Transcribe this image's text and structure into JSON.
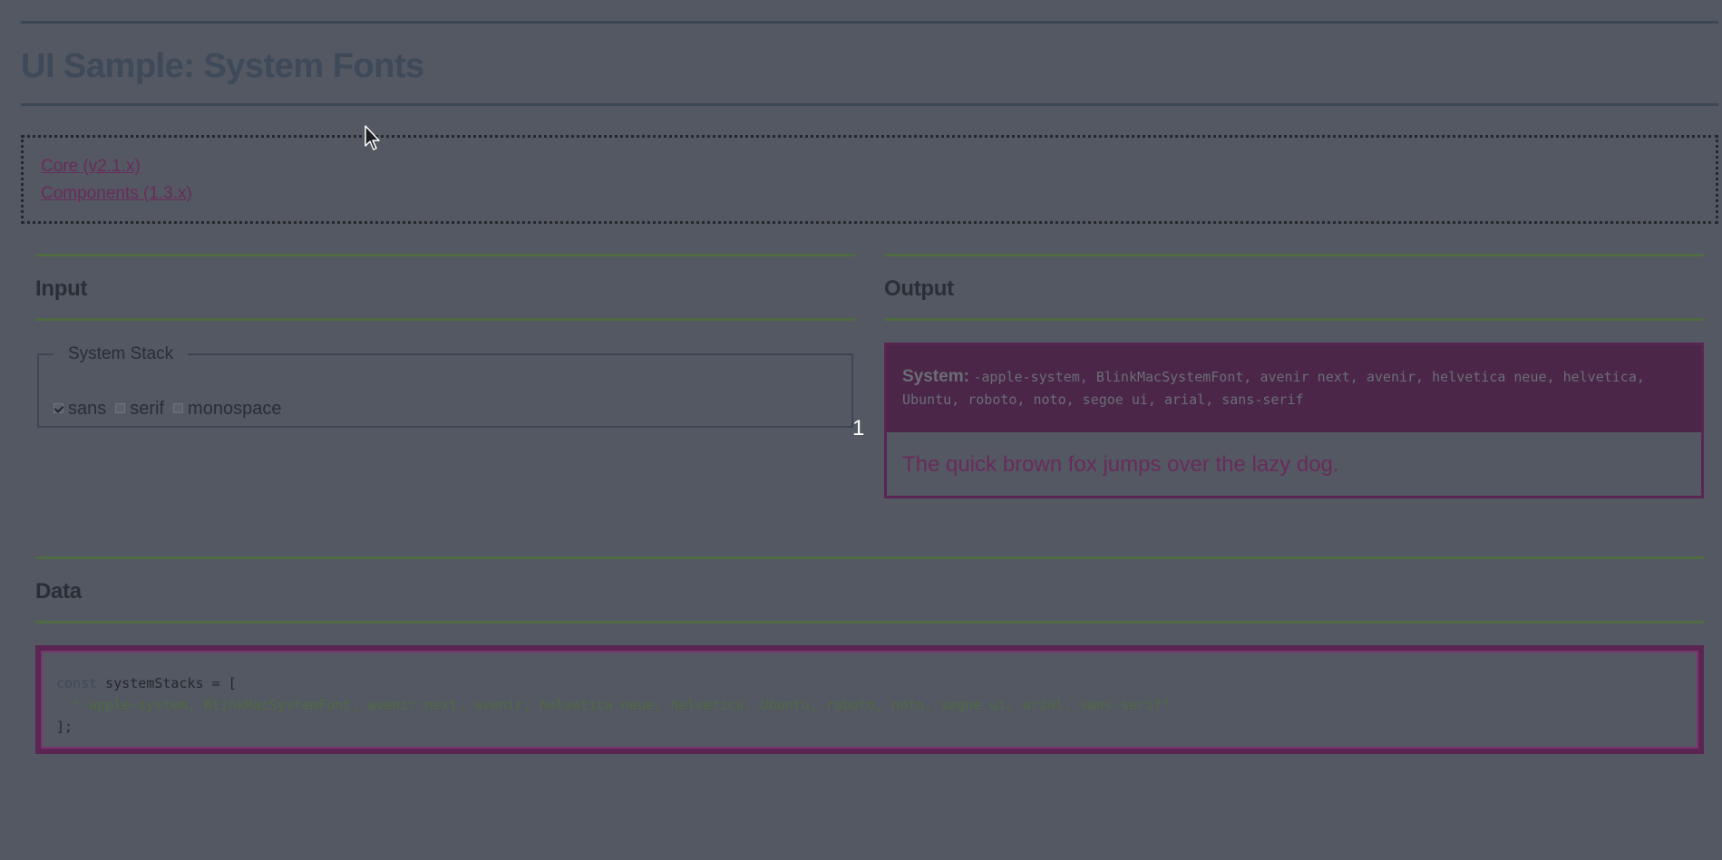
{
  "page": {
    "title": "UI Sample: System Fonts"
  },
  "nav": {
    "links": [
      {
        "label": "Core (v2.1.x)"
      },
      {
        "label": "Components (1.3.x)"
      }
    ]
  },
  "input": {
    "heading": "Input",
    "fieldset_legend": "System Stack",
    "options": [
      {
        "label": "sans",
        "checked": true
      },
      {
        "label": "serif",
        "checked": false
      },
      {
        "label": "monospace",
        "checked": false
      }
    ],
    "marker": "1"
  },
  "output": {
    "heading": "Output",
    "system_label": "System:",
    "system_fonts": "-apple-system, BlinkMacSystemFont, avenir next, avenir, helvetica neue, helvetica, Ubuntu, roboto, noto, segoe ui, arial, sans-serif",
    "sample_text": "The quick brown fox jumps over the lazy dog."
  },
  "data_section": {
    "heading": "Data",
    "code_line1_kw": "const",
    "code_line1_rest": " systemStacks = [",
    "code_line2": "  \"-apple-system, BlinkMacSystemFont, avenir next, avenir, helvetica neue, helvetica, Ubuntu, roboto, noto, segoe ui, arial, sans-serif\"",
    "code_line3": "];"
  },
  "colors": {
    "background": "#535862",
    "accent_green": "#4f6b42",
    "accent_purple": "#5a2552",
    "link": "#6a2b5c"
  }
}
